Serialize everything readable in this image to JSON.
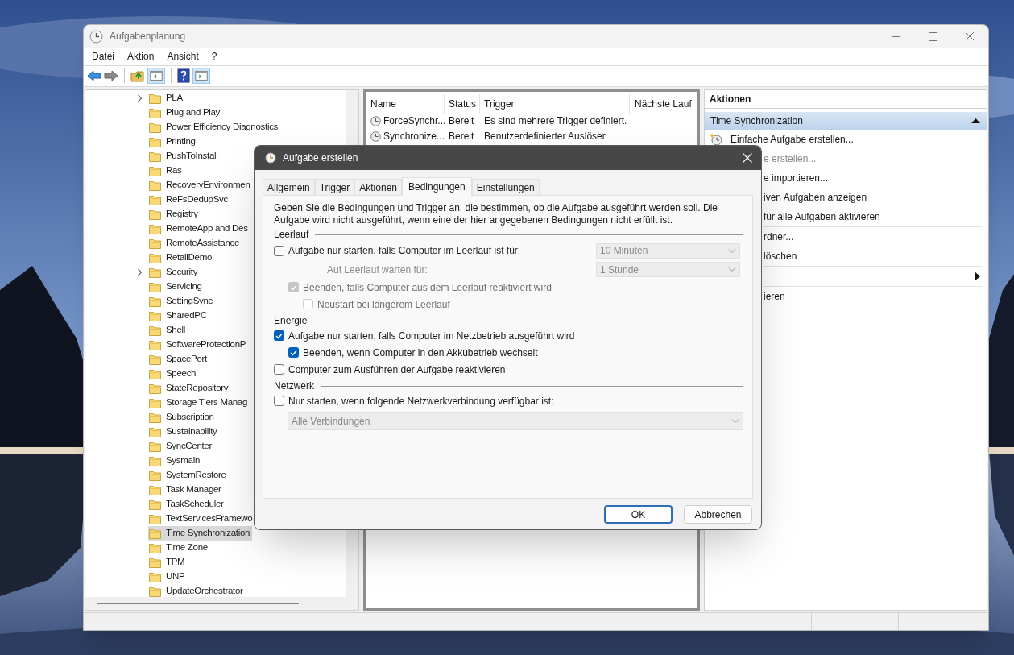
{
  "main_window": {
    "title": "Aufgabenplanung",
    "menu": [
      "Datei",
      "Aktion",
      "Ansicht",
      "?"
    ],
    "tree": {
      "items": [
        {
          "label": "PLA",
          "expandable": true,
          "selected": false
        },
        {
          "label": "Plug and Play",
          "expandable": false,
          "selected": false
        },
        {
          "label": "Power Efficiency Diagnostics",
          "expandable": false,
          "selected": false
        },
        {
          "label": "Printing",
          "expandable": false,
          "selected": false
        },
        {
          "label": "PushToInstall",
          "expandable": false,
          "selected": false
        },
        {
          "label": "Ras",
          "expandable": false,
          "selected": false
        },
        {
          "label": "RecoveryEnvironmen",
          "expandable": false,
          "selected": false
        },
        {
          "label": "ReFsDedupSvc",
          "expandable": false,
          "selected": false
        },
        {
          "label": "Registry",
          "expandable": false,
          "selected": false
        },
        {
          "label": "RemoteApp and Des",
          "expandable": false,
          "selected": false
        },
        {
          "label": "RemoteAssistance",
          "expandable": false,
          "selected": false
        },
        {
          "label": "RetailDemo",
          "expandable": false,
          "selected": false
        },
        {
          "label": "Security",
          "expandable": true,
          "selected": false
        },
        {
          "label": "Servicing",
          "expandable": false,
          "selected": false
        },
        {
          "label": "SettingSync",
          "expandable": false,
          "selected": false
        },
        {
          "label": "SharedPC",
          "expandable": false,
          "selected": false
        },
        {
          "label": "Shell",
          "expandable": false,
          "selected": false
        },
        {
          "label": "SoftwareProtectionP",
          "expandable": false,
          "selected": false
        },
        {
          "label": "SpacePort",
          "expandable": false,
          "selected": false
        },
        {
          "label": "Speech",
          "expandable": false,
          "selected": false
        },
        {
          "label": "StateRepository",
          "expandable": false,
          "selected": false
        },
        {
          "label": "Storage Tiers Manag",
          "expandable": false,
          "selected": false
        },
        {
          "label": "Subscription",
          "expandable": false,
          "selected": false
        },
        {
          "label": "Sustainability",
          "expandable": false,
          "selected": false
        },
        {
          "label": "SyncCenter",
          "expandable": false,
          "selected": false
        },
        {
          "label": "Sysmain",
          "expandable": false,
          "selected": false
        },
        {
          "label": "SystemRestore",
          "expandable": false,
          "selected": false
        },
        {
          "label": "Task Manager",
          "expandable": false,
          "selected": false
        },
        {
          "label": "TaskScheduler",
          "expandable": false,
          "selected": false
        },
        {
          "label": "TextServicesFramewo",
          "expandable": false,
          "selected": false
        },
        {
          "label": "Time Synchronization",
          "expandable": false,
          "selected": true
        },
        {
          "label": "Time Zone",
          "expandable": false,
          "selected": false
        },
        {
          "label": "TPM",
          "expandable": false,
          "selected": false
        },
        {
          "label": "UNP",
          "expandable": false,
          "selected": false
        },
        {
          "label": "UpdateOrchestrator",
          "expandable": false,
          "selected": false
        }
      ]
    },
    "task_list": {
      "columns": [
        "Name",
        "Status",
        "Trigger",
        "Nächste Lauf"
      ],
      "rows": [
        {
          "name": "ForceSynchr...",
          "status": "Bereit",
          "trigger": "Es sind mehrere Trigger definiert."
        },
        {
          "name": "Synchronize...",
          "status": "Bereit",
          "trigger": "Benutzerdefinierter Auslöser"
        }
      ]
    },
    "actions_pane": {
      "title": "Aktionen",
      "section": {
        "label": "Time Synchronization",
        "expanded": true
      },
      "items": [
        {
          "kind": "full",
          "label": "Einfache Aufgabe erstellen...",
          "disabled": false
        },
        {
          "kind": "partial",
          "label": "e erstellen...",
          "disabled": true
        },
        {
          "kind": "partial",
          "label": "e importieren...",
          "disabled": false
        },
        {
          "kind": "partial",
          "label": "iven Aufgaben anzeigen",
          "disabled": false
        },
        {
          "kind": "partial",
          "label": "für alle Aufgaben aktivieren",
          "disabled": false
        },
        {
          "kind": "separator"
        },
        {
          "kind": "partial",
          "label": "rdner...",
          "disabled": false
        },
        {
          "kind": "partial",
          "label": "löschen",
          "disabled": false
        },
        {
          "kind": "separator"
        },
        {
          "kind": "submenu"
        },
        {
          "kind": "separator"
        },
        {
          "kind": "partial",
          "label": "ieren",
          "disabled": false
        }
      ]
    }
  },
  "dialog": {
    "title": "Aufgabe erstellen",
    "tabs": [
      {
        "label": "Allgemein",
        "selected": false
      },
      {
        "label": "Trigger",
        "selected": false
      },
      {
        "label": "Aktionen",
        "selected": false
      },
      {
        "label": "Bedingungen",
        "selected": true
      },
      {
        "label": "Einstellungen",
        "selected": false
      }
    ],
    "description": "Geben Sie die Bedingungen und Trigger an, die bestimmen, ob die Aufgabe ausgeführt werden soll. Die Aufgabe wird nicht ausgeführt, wenn eine der hier angegebenen Bedingungen nicht erfüllt ist.",
    "sections": [
      {
        "title": "Leerlauf",
        "rows": [
          {
            "kind": "checkbox",
            "label": "Aufgabe nur starten, falls Computer im Leerlauf ist für:",
            "checked": false,
            "disabled": false,
            "select": {
              "value": "10 Minuten",
              "disabled": true
            },
            "children": [
              {
                "kind": "label",
                "label": "Auf Leerlauf warten für:",
                "disabled": true,
                "select": {
                  "value": "1 Stunde",
                  "disabled": true
                }
              },
              {
                "kind": "checkbox",
                "label": "Beenden, falls Computer aus dem Leerlauf reaktiviert wird",
                "checked": true,
                "disabled": true,
                "children": [
                  {
                    "kind": "checkbox",
                    "label": "Neustart bei längerem Leerlauf",
                    "checked": false,
                    "disabled": true
                  }
                ]
              }
            ]
          }
        ]
      },
      {
        "title": "Energie",
        "rows": [
          {
            "kind": "checkbox",
            "label": "Aufgabe nur starten, falls Computer im Netzbetrieb ausgeführt wird",
            "checked": true,
            "disabled": false,
            "children": [
              {
                "kind": "checkbox",
                "label": "Beenden, wenn Computer in den Akkubetrieb wechselt",
                "checked": true,
                "disabled": false
              }
            ]
          },
          {
            "kind": "checkbox",
            "label": "Computer zum Ausführen der Aufgabe reaktivieren",
            "checked": false,
            "disabled": false
          }
        ]
      },
      {
        "title": "Netzwerk",
        "rows": [
          {
            "kind": "checkbox",
            "label": "Nur starten, wenn folgende Netzwerkverbindung verfügbar ist:",
            "checked": false,
            "disabled": false,
            "children": [
              {
                "kind": "select",
                "value": "Alle Verbindungen",
                "disabled": true
              }
            ]
          }
        ]
      }
    ],
    "buttons": [
      {
        "label": "OK",
        "default": true
      },
      {
        "label": "Abbrechen",
        "default": false
      }
    ]
  }
}
